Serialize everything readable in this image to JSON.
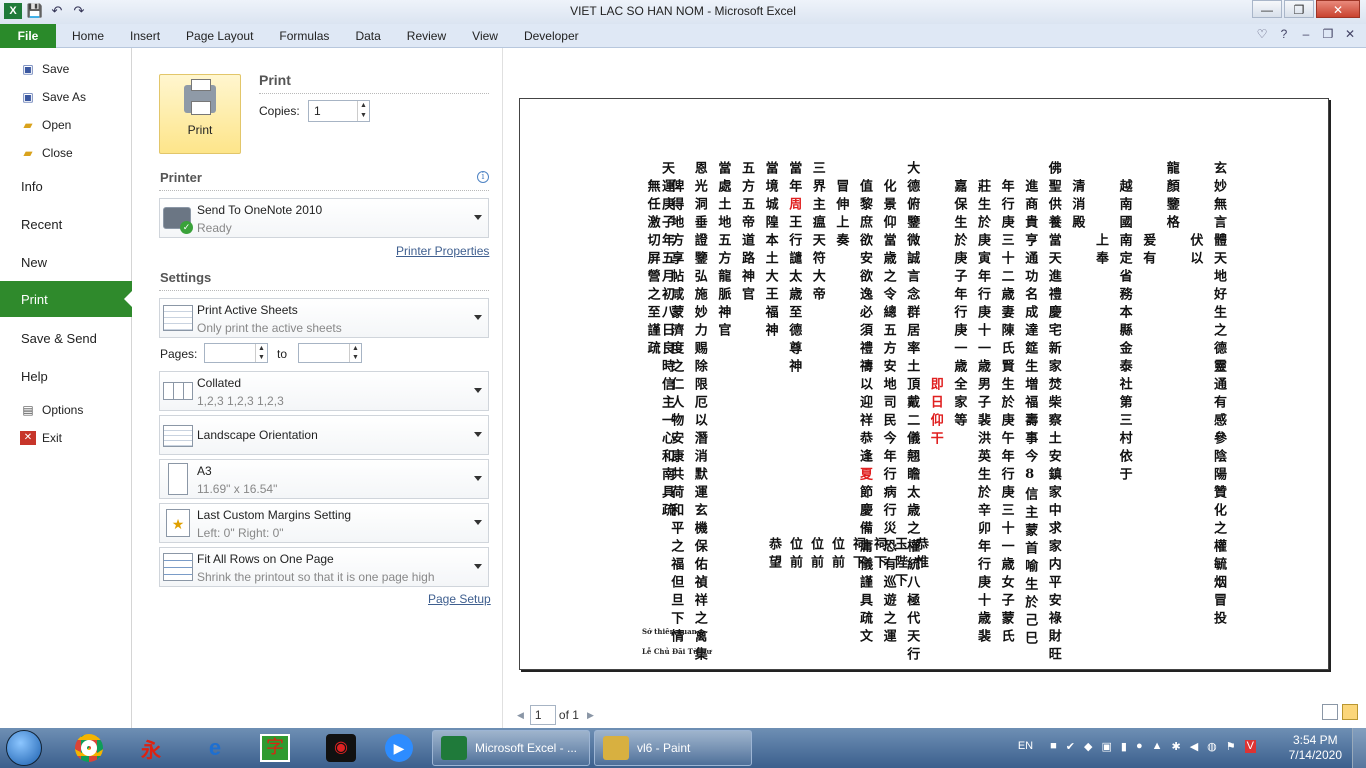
{
  "window": {
    "title": "VIET LAC SO HAN NOM  -  Microsoft Excel",
    "minimize": "—",
    "maximize": "❐",
    "close": "✕"
  },
  "qat": {
    "save_icon": "💾",
    "undo_icon": "↶",
    "redo_icon": "↷"
  },
  "ribbon": {
    "file_tab": "File",
    "tabs": [
      "Home",
      "Insert",
      "Page Layout",
      "Formulas",
      "Data",
      "Review",
      "View",
      "Developer"
    ]
  },
  "nav": {
    "save": "Save",
    "save_as": "Save As",
    "open": "Open",
    "close": "Close",
    "info": "Info",
    "recent": "Recent",
    "new": "New",
    "print": "Print",
    "save_send": "Save & Send",
    "help": "Help",
    "options": "Options",
    "exit": "Exit"
  },
  "print_panel": {
    "heading": "Print",
    "print_button": "Print",
    "copies_label": "Copies:",
    "copies_value": "1",
    "printer_heading": "Printer",
    "printer_name": "Send To OneNote 2010",
    "printer_status": "Ready",
    "printer_properties": "Printer Properties",
    "settings_heading": "Settings",
    "active_sheets_title": "Print Active Sheets",
    "active_sheets_desc": "Only print the active sheets",
    "pages_label": "Pages:",
    "pages_to": "to",
    "collated_title": "Collated",
    "collated_desc": "1,2,3    1,2,3    1,2,3",
    "orientation": "Landscape Orientation",
    "paper_title": "A3",
    "paper_desc": "11.69\" x 16.54\"",
    "margins_title": "Last Custom Margins Setting",
    "margins_desc": "Left: 0\"    Right: 0\"",
    "scaling_title": "Fit All Rows on One Page",
    "scaling_desc": "Shrink the printout so that it is one page high",
    "page_setup": "Page Setup"
  },
  "preview": {
    "page_number": "1",
    "page_of": "of 1",
    "columns": [
      {
        "text": "玄妙無言體天地好生之德靈通有感參陰陽贊化之權毓烟冒投",
        "red": false
      },
      {
        "text": "伏以",
        "red": false,
        "offset": 8
      },
      {
        "text": "龍顏鑒格",
        "red": false
      },
      {
        "text": "爰有",
        "red": false,
        "offset": 8
      },
      {
        "text": "越南國南定省務本縣金泰社第三村依于",
        "red": false,
        "offset": 2
      },
      {
        "text": "上奉",
        "red": false,
        "offset": 8
      },
      {
        "text": "清消殿",
        "red": false,
        "offset": 2
      },
      {
        "text": "佛聖供養當天進禮慶宅新家焚柴察土安鎮家中求家内平安祿財旺",
        "red": false
      },
      {
        "text": "進商貴亨通功名成達筵生増福壽事今8信主蒙首喻生於己巳",
        "red": false,
        "offset": 2
      },
      {
        "text": "年行庚三十二歳妻陳氏賢生於庚午年行庚三十一歳女子蒙氏",
        "red": false,
        "offset": 2
      },
      {
        "text": "莊生於庚寅年行庚十一歳男子裴洪英生於辛卯年行庚十歳裴",
        "red": false,
        "offset": 2
      },
      {
        "text": "嘉保生於庚子年行庚一歳全家等",
        "red": false,
        "offset": 2
      },
      {
        "text": "即日仰干",
        "red": true,
        "offset": 24
      },
      {
        "text": "大德俯鑒微誠言念群居率土頂戴二儀翹瞻太歳之權統八極代天行",
        "red": false
      },
      {
        "text": "化景仰當歳之令總五方安地司民今年行病行災恐有巡遊之運",
        "red": false,
        "offset": 2
      },
      {
        "text": "值黎庶欲安欲逸必須禮禱以迎祥恭逢夏節慶備庸儀謹具疏文",
        "red": false,
        "offset": 2
      },
      {
        "text": "冒伸上奏",
        "red": false,
        "offset": 2
      },
      {
        "text": "三界主瘟天符大帝",
        "red": false
      },
      {
        "text": "當年周王行譴太歳至德尊神",
        "red": false
      },
      {
        "text": "當境城隍本土大王福神",
        "red": false
      },
      {
        "text": "五方五帝道路神官",
        "red": false
      },
      {
        "text": "當處土地五方龍脈神官",
        "red": false
      },
      {
        "text": "恩光洞垂證鑒弘施妙力赐除限厄以潛消默運玄機保佑禎祥之禽集",
        "red": false
      },
      {
        "text": "俾得地方享帖咸蒙濟度之仁人物安康共荷和平之福但旦下情",
        "red": false,
        "offset": 2
      },
      {
        "text": "無任激切屏營之至謹疏",
        "red": false,
        "offset": 2
      },
      {
        "text": "天運庚子年五月初八日良時信主一心和南具疏",
        "red": false
      }
    ],
    "red_chars": {
      "zhou": "周",
      "xia": "夏"
    },
    "lower_entries": [
      "恭惟",
      "玉陛下",
      "祠下",
      "祠下",
      "位前",
      "位前",
      "位前",
      "恭望"
    ],
    "signature_1": "Sớ thiên quan",
    "signature_2": "Lễ Chủ Đãi Từ Dư"
  },
  "taskbar": {
    "apps": [
      {
        "label": "Microsoft Excel - ...",
        "color": "#1f7a3a"
      },
      {
        "label": "vl6 - Paint",
        "color": "#d8b040"
      }
    ],
    "language": "EN",
    "time": "3:54 PM",
    "date": "7/14/2020"
  }
}
